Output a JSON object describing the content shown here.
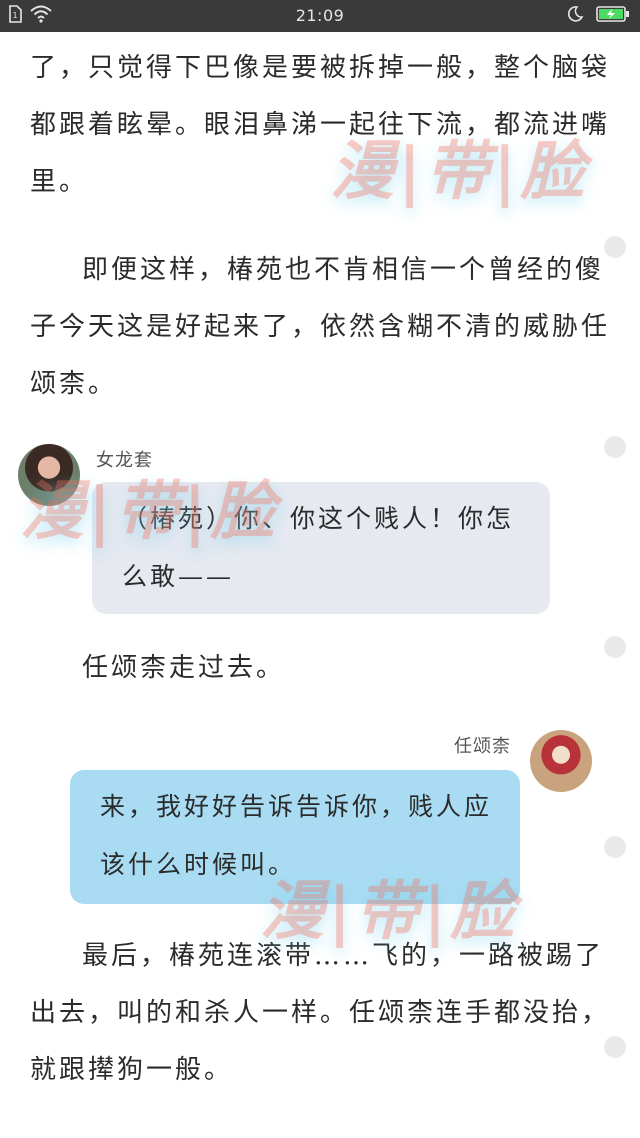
{
  "status_bar": {
    "time": "21:09"
  },
  "paragraphs": {
    "p1": "了，只觉得下巴像是要被拆掉一般，整个脑袋都跟着眩晕。眼泪鼻涕一起往下流，都流进嘴里。",
    "p2": "即便这样，椿苑也不肯相信一个曾经的傻子今天这是好起来了，依然含糊不清的威胁任颂柰。",
    "p3": "任颂柰走过去。",
    "p4": "最后，椿苑连滚带……飞的，一路被踢了出去，叫的和杀人一样。任颂柰连手都没抬，就跟撵狗一般。"
  },
  "dialogue": {
    "left": {
      "speaker": "女龙套",
      "text": "（椿苑）你、你这个贱人！你怎么敢——"
    },
    "right": {
      "speaker": "任颂柰",
      "text": "来，我好好告诉告诉你，贱人应该什么时候叫。"
    }
  },
  "watermark": "漫|带|脸",
  "colors": {
    "status_bar_bg": "#3a3a3a",
    "left_bubble": "#e6e9f0",
    "right_bubble": "#a9dcf3",
    "battery_charging": "#4cd964"
  }
}
